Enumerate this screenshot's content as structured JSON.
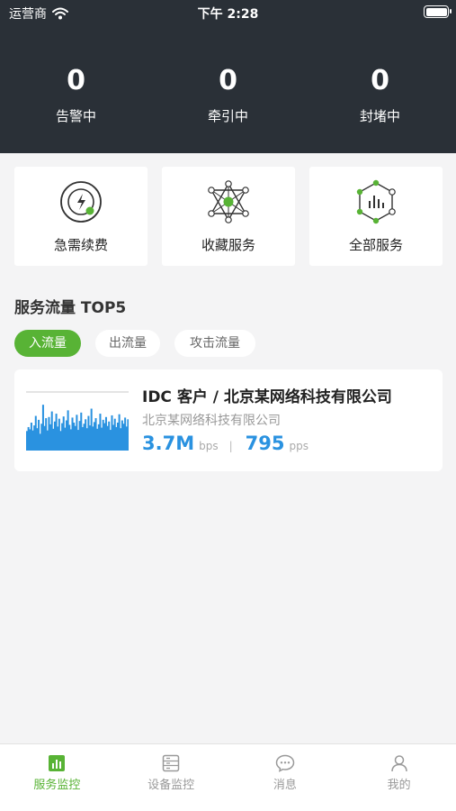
{
  "status_bar": {
    "carrier": "运营商",
    "time": "下午 2:28"
  },
  "stats": [
    {
      "value": "0",
      "label": "告警中"
    },
    {
      "value": "0",
      "label": "牵引中"
    },
    {
      "value": "0",
      "label": "封堵中"
    }
  ],
  "quick_actions": [
    {
      "label": "急需续费",
      "icon": "renew-icon"
    },
    {
      "label": "收藏服务",
      "icon": "favorite-network-icon"
    },
    {
      "label": "全部服务",
      "icon": "all-services-icon"
    }
  ],
  "section": {
    "title": "服务流量 TOP5"
  },
  "filters": [
    {
      "label": "入流量",
      "active": true
    },
    {
      "label": "出流量",
      "active": false
    },
    {
      "label": "攻击流量",
      "active": false
    }
  ],
  "service_card": {
    "title": "IDC 客户 / 北京某网络科技有限公司",
    "subtitle": "北京某网络科技有限公司",
    "bandwidth": "3.7M",
    "bandwidth_unit": "bps",
    "separator": "|",
    "packets": "795",
    "packets_unit": "pps",
    "sparkline_color": "#2a92e0",
    "sparkline": [
      0.35,
      0.42,
      0.38,
      0.5,
      0.36,
      0.45,
      0.62,
      0.4,
      0.55,
      0.3,
      0.48,
      0.82,
      0.44,
      0.58,
      0.36,
      0.6,
      0.47,
      0.7,
      0.39,
      0.52,
      0.66,
      0.43,
      0.57,
      0.35,
      0.49,
      0.61,
      0.41,
      0.54,
      0.72,
      0.46,
      0.38,
      0.59,
      0.5,
      0.44,
      0.64,
      0.37,
      0.53,
      0.68,
      0.42,
      0.48,
      0.56,
      0.4,
      0.62,
      0.45,
      0.75,
      0.43,
      0.51,
      0.58,
      0.39,
      0.47,
      0.66,
      0.41,
      0.55,
      0.49,
      0.6,
      0.44,
      0.52,
      0.37,
      0.63,
      0.46,
      0.57,
      0.42,
      0.5,
      0.65,
      0.4,
      0.54,
      0.48,
      0.59,
      0.43,
      0.56
    ]
  },
  "tabbar": [
    {
      "label": "服务监控",
      "icon": "bar-chart-icon",
      "active": true
    },
    {
      "label": "设备监控",
      "icon": "device-list-icon",
      "active": false
    },
    {
      "label": "消息",
      "icon": "message-bubble-icon",
      "active": false
    },
    {
      "label": "我的",
      "icon": "user-icon",
      "active": false
    }
  ],
  "colors": {
    "header_bg": "#2a3037",
    "accent_green": "#58b335",
    "metric_blue": "#2a92e0"
  }
}
